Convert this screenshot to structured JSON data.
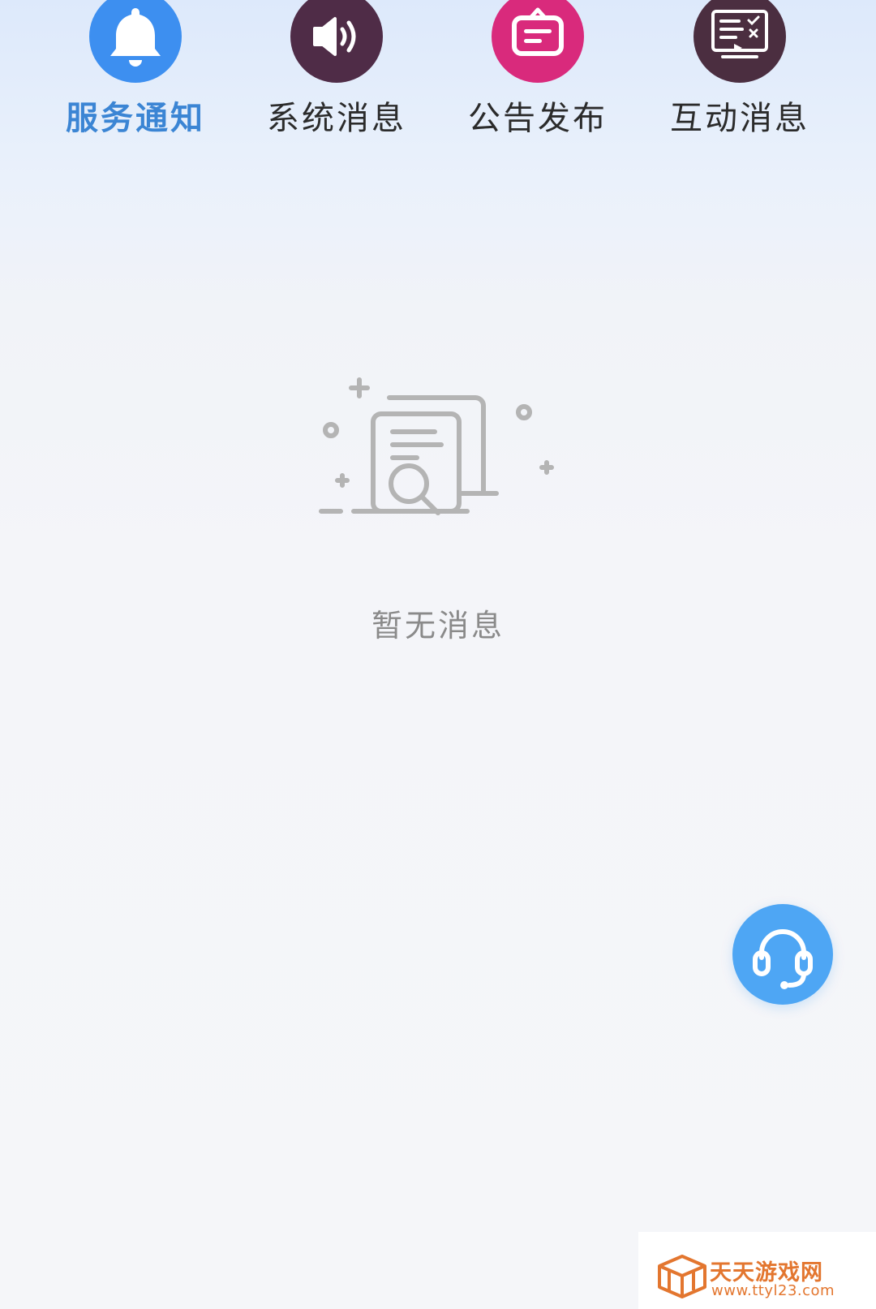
{
  "tabs": [
    {
      "label": "服务通知",
      "icon": "bell-icon",
      "color": "#3d8ff0",
      "active": true
    },
    {
      "label": "系统消息",
      "icon": "speaker-icon",
      "color": "#4f2c47",
      "active": false
    },
    {
      "label": "公告发布",
      "icon": "notice-board-icon",
      "color": "#d92a7c",
      "active": false
    },
    {
      "label": "互动消息",
      "icon": "monitor-checklist-icon",
      "color": "#4b2e40",
      "active": false
    }
  ],
  "empty_state": {
    "icon": "empty-document-search-icon",
    "text": "暂无消息"
  },
  "support": {
    "icon": "headset-icon",
    "color": "#4ea6f4"
  },
  "watermark": {
    "name": "天天游戏网",
    "url": "www.ttyl23.com",
    "color": "#e3762f"
  }
}
